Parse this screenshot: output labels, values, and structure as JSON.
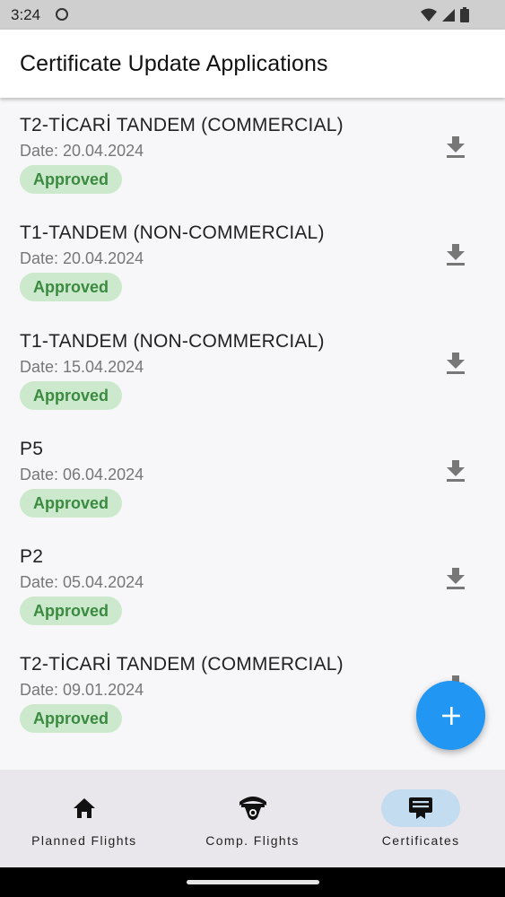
{
  "status_bar": {
    "time": "3:24"
  },
  "app_bar": {
    "title": "Certificate Update Applications"
  },
  "applications": [
    {
      "title": "T2-TİCARİ TANDEM (COMMERCIAL)",
      "date": "Date: 20.04.2024",
      "status": "Approved"
    },
    {
      "title": "T1-TANDEM (NON-COMMERCIAL)",
      "date": "Date: 20.04.2024",
      "status": "Approved"
    },
    {
      "title": "T1-TANDEM (NON-COMMERCIAL)",
      "date": "Date: 15.04.2024",
      "status": "Approved"
    },
    {
      "title": "P5",
      "date": "Date: 06.04.2024",
      "status": "Approved"
    },
    {
      "title": "P2",
      "date": "Date: 05.04.2024",
      "status": "Approved"
    },
    {
      "title": "T2-TİCARİ TANDEM (COMMERCIAL)",
      "date": "Date: 09.01.2024",
      "status": "Approved"
    }
  ],
  "fab": {
    "icon": "plus-icon"
  },
  "bottom_nav": {
    "items": [
      {
        "label": "Planned Flights",
        "icon": "home-icon",
        "active": false
      },
      {
        "label": "Comp. Flights",
        "icon": "paraglider-icon",
        "active": false
      },
      {
        "label": "Certificates",
        "icon": "certificate-icon",
        "active": true
      }
    ]
  },
  "colors": {
    "accent": "#2196f3",
    "status_bg": "#cde9cd",
    "status_text": "#3a8a3f",
    "active_nav_bg": "#c4dcf0"
  }
}
